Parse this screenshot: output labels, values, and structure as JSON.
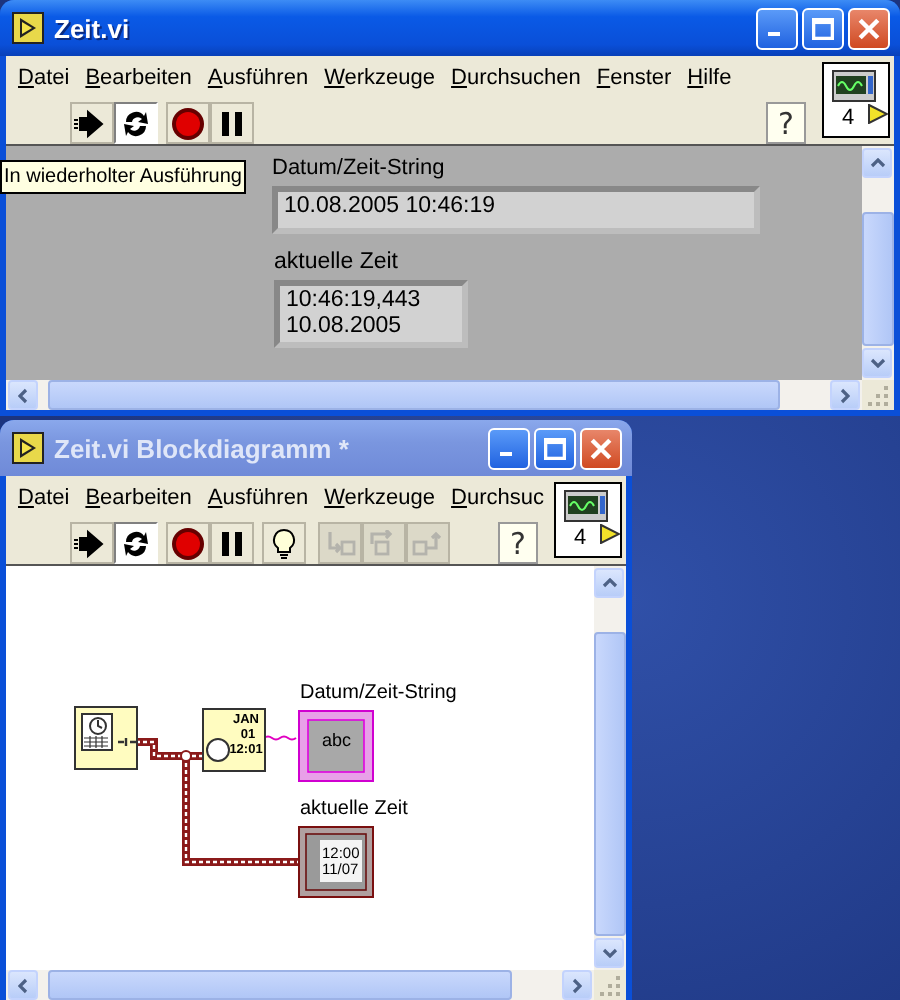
{
  "windows": [
    {
      "kind": "front_panel",
      "title": "Zeit.vi",
      "active": true,
      "menu": [
        {
          "label": "Datei"
        },
        {
          "label": "Bearbeiten"
        },
        {
          "label": "Ausführen"
        },
        {
          "label": "Werkzeuge"
        },
        {
          "label": "Durchsuchen"
        },
        {
          "label": "Fenster"
        },
        {
          "label": "Hilfe"
        }
      ],
      "toolbar": [
        {
          "kind": "run",
          "pressed": false,
          "disabled": false
        },
        {
          "kind": "run_continuously",
          "pressed": true,
          "disabled": false
        },
        {
          "kind": "abort",
          "pressed": false,
          "disabled": false
        },
        {
          "kind": "pause",
          "pressed": false,
          "disabled": false
        }
      ],
      "help_label": "?",
      "connector_label": "4",
      "tooltip": "In wiederholter Ausführung",
      "controls": [
        {
          "kind": "string",
          "label": "Datum/Zeit-String",
          "lines": [
            "10.08.2005 10:46:19"
          ]
        },
        {
          "kind": "timestamp",
          "label": "aktuelle Zeit",
          "lines": [
            "10:46:19,443",
            "10.08.2005"
          ]
        }
      ]
    },
    {
      "kind": "block_diagram",
      "title": "Zeit.vi Blockdiagramm *",
      "active": false,
      "menu": [
        {
          "label": "Datei"
        },
        {
          "label": "Bearbeiten"
        },
        {
          "label": "Ausführen"
        },
        {
          "label": "Werkzeuge"
        },
        {
          "label": "Durchsuc"
        }
      ],
      "toolbar": [
        {
          "kind": "run",
          "pressed": false,
          "disabled": false
        },
        {
          "kind": "run_continuously",
          "pressed": true,
          "disabled": false
        },
        {
          "kind": "abort",
          "pressed": false,
          "disabled": false
        },
        {
          "kind": "pause",
          "pressed": false,
          "disabled": false
        },
        {
          "kind": "highlight",
          "pressed": false,
          "disabled": false
        },
        {
          "kind": "step_into",
          "pressed": false,
          "disabled": true
        },
        {
          "kind": "step_over",
          "pressed": false,
          "disabled": true
        },
        {
          "kind": "step_out",
          "pressed": false,
          "disabled": true
        }
      ],
      "help_label": "?",
      "connector_label": "4",
      "nodes": [
        {
          "kind": "get_date_time"
        },
        {
          "kind": "format_date_time",
          "lines": [
            "JAN",
            "01",
            "12:01"
          ]
        }
      ],
      "terminals": [
        {
          "kind": "string",
          "label": "Datum/Zeit-String",
          "lines": [
            "abc"
          ]
        },
        {
          "kind": "timestamp",
          "label": "aktuelle Zeit",
          "lines": [
            "12:00",
            "11/07"
          ]
        }
      ]
    }
  ]
}
